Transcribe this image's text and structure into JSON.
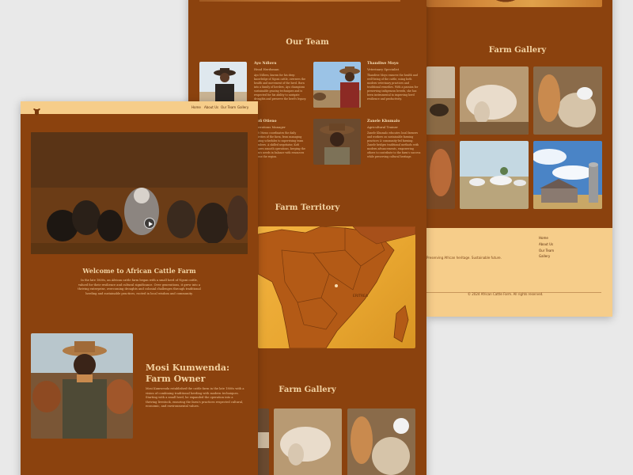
{
  "back_page": {
    "gallery_title": "Farm Gallery",
    "footer": {
      "links": [
        "Home",
        "About Us",
        "Our Team",
        "Gallery"
      ],
      "tagline": "Preserving African heritage. Sustainable future.",
      "copyright": "© 2024 African Cattle Farm. All rights reserved."
    }
  },
  "middle_page": {
    "team_title": "Our Team",
    "members": [
      {
        "name": "Ayo Ndlovu",
        "role": "Head Herdsman",
        "bio": "Ayo Ndlovu, known for his deep knowledge of Ngoni cattle, oversees the health and movement of the herd. Born into a family of herders, Ayo champions sustainable grazing techniques and is respected for his ability to navigate droughts and preserve the herd's legacy."
      },
      {
        "name": "Thandiwe Moyo",
        "role": "Veterinary Specialist",
        "bio": "Thandiwe Moyo ensures the health and well-being of the cattle, using both modern veterinary practices and traditional remedies. With a passion for preserving indigenous breeds, she has been instrumental in improving herd resilience and productivity."
      },
      {
        "name": "Kofi Otieno",
        "role": "Operations Manager",
        "bio": "Kofi Otieno coordinates the daily activities of the farm, from managing grazing schedules to supervising team members. A skilled negotiator, Kofi ensures smooth operations, keeping the farm's needs in balance with resources across the region."
      },
      {
        "name": "Zanele Khumalo",
        "role": "Agricultural Trainer",
        "bio": "Zanele Khumalo educates local farmers and workers on sustainable farming practices & community-led farming. Zanele bridges traditional methods with modern advancements, empowering others to contribute to the farm's success while preserving cultural heritage."
      }
    ],
    "territory_title": "Farm Territory",
    "map_label": "ERITREA",
    "gallery_title": "Farm Gallery"
  },
  "front_page": {
    "nav": [
      "Home",
      "About Us",
      "Our Team",
      "Gallery"
    ],
    "welcome_title": "Welcome to African Cattle Farm",
    "welcome_text": "In the late 1800s, an African cattle farm began with a small herd of Ngoni cattle, valued for their resilience and cultural significance. Over generations, it grew into a thriving enterprise, overcoming droughts and colonial challenges through traditional herding and sustainable practices, rooted in local wisdom and community.",
    "owner_title": "Mosi Kumwenda: Farm Owner",
    "owner_bio": "Mosi Kumwenda established the cattle farm in the late 1800s with a vision of combining traditional herding with modern techniques. Starting with a small herd, he expanded the operation into a thriving livestock, ensuring the farm's practices respected cultural, economic, and environmental values."
  },
  "colors": {
    "brown": "#8b420e",
    "sand": "#f6cd8a",
    "text_light": "#f2d3a3"
  }
}
